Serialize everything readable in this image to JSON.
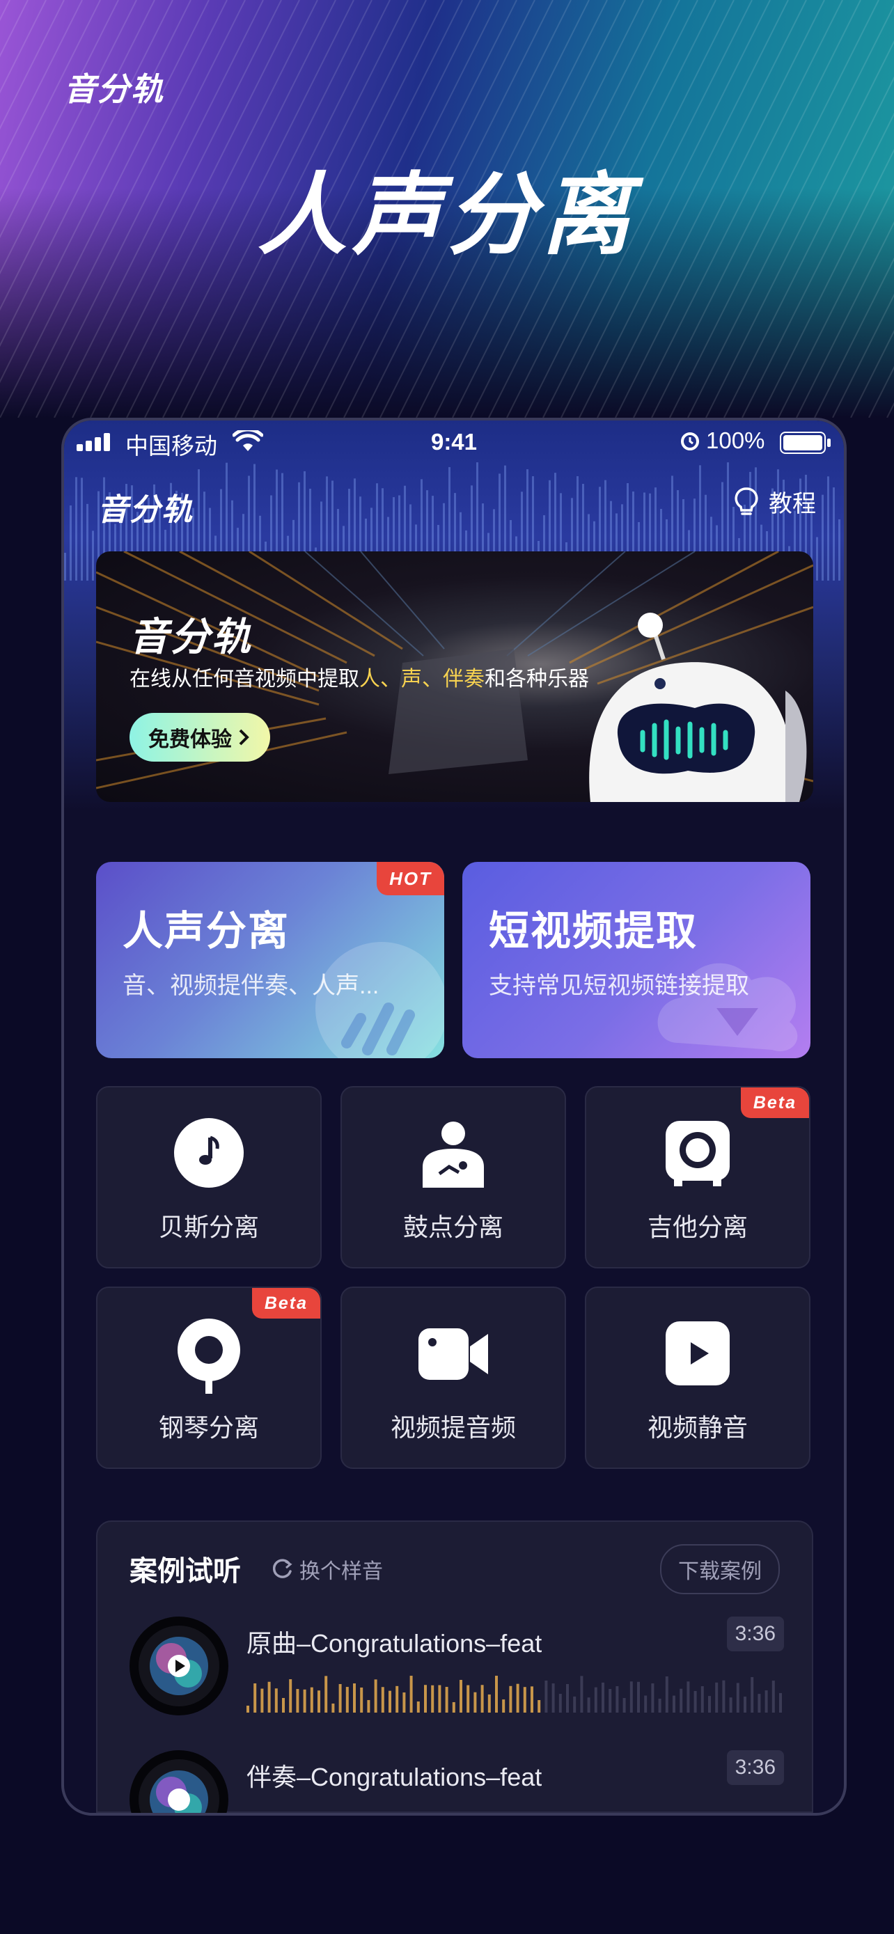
{
  "poster": {
    "brand": "音分轨",
    "title": "人声分离"
  },
  "status_bar": {
    "carrier": "中国移动",
    "time": "9:41",
    "battery": "100%"
  },
  "nav": {
    "brand": "音分轨",
    "help_label": "教程"
  },
  "banner": {
    "title": "音分轨",
    "subtitle_prefix": "在线从任何音视频中提取",
    "subtitle_hl1": "人",
    "subtitle_sep1": "、",
    "subtitle_hl2": "声",
    "subtitle_sep2": "、",
    "subtitle_hl3": "伴奏",
    "subtitle_suffix": "和各种乐器",
    "button": "免费体验"
  },
  "features": [
    {
      "title": "人声分离",
      "subtitle": "音、视频提伴奏、人声...",
      "tag": "HOT"
    },
    {
      "title": "短视频提取",
      "subtitle": "支持常见短视频链接提取"
    }
  ],
  "tools": [
    {
      "label": "贝斯分离",
      "icon": "music-note-icon"
    },
    {
      "label": "鼓点分离",
      "icon": "drummer-icon"
    },
    {
      "label": "吉他分离",
      "icon": "guitar-amp-icon",
      "tag": "Beta"
    },
    {
      "label": "钢琴分离",
      "icon": "piano-pin-icon",
      "tag": "Beta"
    },
    {
      "label": "视频提音频",
      "icon": "video-camera-icon"
    },
    {
      "label": "视频静音",
      "icon": "play-icon"
    }
  ],
  "cases": {
    "title": "案例试听",
    "swap_label": "换个样音",
    "download_label": "下载案例",
    "tracks": [
      {
        "name": "原曲–Congratulations–feat",
        "duration": "3:36"
      },
      {
        "name": "伴奏–Congratulations–feat",
        "duration": "3:36"
      }
    ]
  },
  "colors": {
    "background": "#0b0a26",
    "highlight": "#f7d250",
    "tag_red": "#e8453c",
    "wave_active": "#c8964a",
    "wave_inactive": "#3b3b55"
  }
}
